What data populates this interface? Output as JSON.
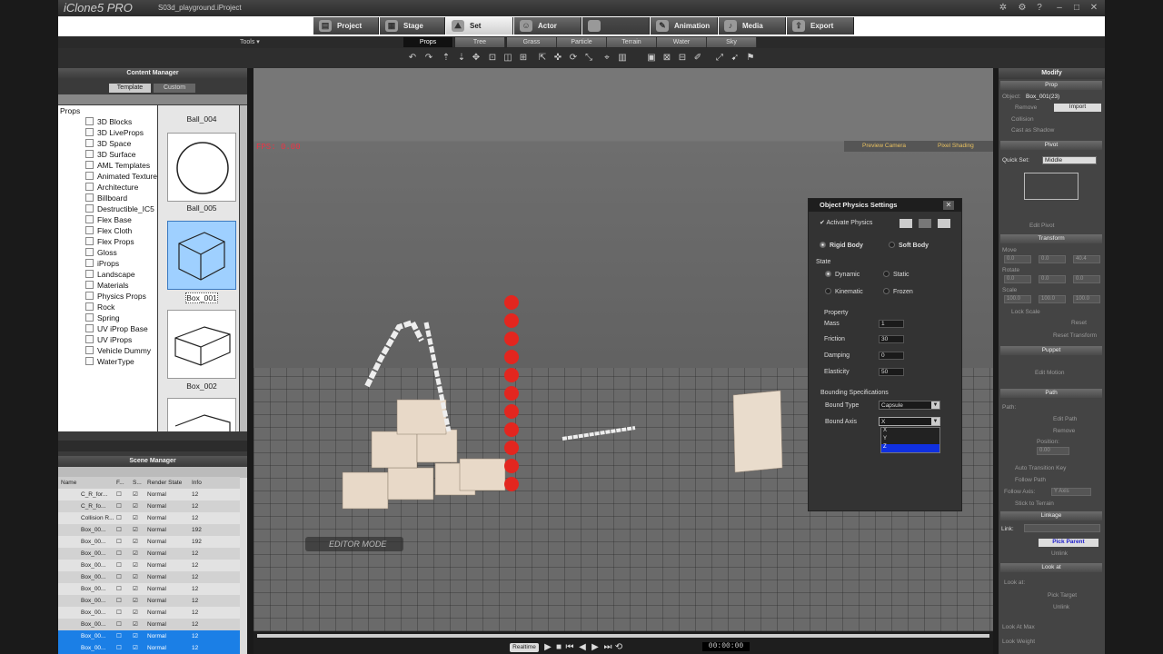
{
  "app": {
    "logo": "iClone5 PRO",
    "file": "S03d_playground.iProject"
  },
  "main_tabs": [
    {
      "label": "Project",
      "icon": "project-icon"
    },
    {
      "label": "Stage",
      "icon": "stage-icon"
    },
    {
      "label": "Set",
      "icon": "set-icon"
    },
    {
      "label": "Actor",
      "icon": "actor-icon"
    },
    {
      "label": "",
      "icon": "disabled-icon"
    },
    {
      "label": "Animation",
      "icon": "animation-icon"
    },
    {
      "label": "Media",
      "icon": "media-icon"
    },
    {
      "label": "Export",
      "icon": "export-icon"
    }
  ],
  "tools_menu": "Tools ▾",
  "sub_tabs": [
    "Props",
    "Tree",
    "Grass",
    "Particle",
    "Terrain",
    "Water",
    "Sky"
  ],
  "content_manager": {
    "title": "Content Manager",
    "tabs": [
      "Template",
      "Custom"
    ],
    "tree_root": "Props",
    "tree": [
      "3D Blocks",
      "3D LiveProps",
      "3D Space",
      "3D Surface",
      "AML Templates",
      "Animated Texture",
      "Architecture",
      "Billboard",
      "Destructible_IC5",
      "Flex Base",
      "Flex Cloth",
      "Flex Props",
      "Gloss",
      "iProps",
      "Landscape",
      "Materials",
      "Physics Props",
      "Rock",
      "Spring",
      "UV iProp Base",
      "UV iProps",
      "Vehicle Dummy",
      "WaterType"
    ],
    "thumbs": [
      "Ball_004",
      "Ball_005",
      "Box_001",
      "Box_002"
    ]
  },
  "scene_manager": {
    "title": "Scene Manager",
    "columns": [
      "Name",
      "F...",
      "S...",
      "Render State",
      "Info"
    ],
    "rows": [
      {
        "name": "C_R_for...",
        "state": "Normal",
        "info": "12"
      },
      {
        "name": "C_R_fo...",
        "state": "Normal",
        "info": "12"
      },
      {
        "name": "Collision R...",
        "state": "Normal",
        "info": "12"
      },
      {
        "name": "Box_00...",
        "state": "Normal",
        "info": "192"
      },
      {
        "name": "Box_00...",
        "state": "Normal",
        "info": "192"
      },
      {
        "name": "Box_00...",
        "state": "Normal",
        "info": "12"
      },
      {
        "name": "Box_00...",
        "state": "Normal",
        "info": "12"
      },
      {
        "name": "Box_00...",
        "state": "Normal",
        "info": "12"
      },
      {
        "name": "Box_00...",
        "state": "Normal",
        "info": "12"
      },
      {
        "name": "Box_00...",
        "state": "Normal",
        "info": "12"
      },
      {
        "name": "Box_00...",
        "state": "Normal",
        "info": "12"
      },
      {
        "name": "Box_00...",
        "state": "Normal",
        "info": "12"
      },
      {
        "name": "Box_00...",
        "state": "Normal",
        "info": "12"
      },
      {
        "name": "Box_00...",
        "state": "Normal",
        "info": "12"
      }
    ]
  },
  "viewport": {
    "fps": "FPS: 0.00",
    "preview_camera": "Preview Camera",
    "pixel_shading": "Pixel Shading",
    "editor_mode": "EDITOR MODE"
  },
  "physics": {
    "title": "Object Physics Settings",
    "activate": "Activate Physics",
    "rigid": "Rigid Body",
    "soft": "Soft Body",
    "state_label": "State",
    "states": [
      "Dynamic",
      "Static",
      "Kinematic",
      "Frozen"
    ],
    "property_label": "Property",
    "props": [
      {
        "label": "Mass",
        "value": "1"
      },
      {
        "label": "Friction",
        "value": "30"
      },
      {
        "label": "Damping",
        "value": "0"
      },
      {
        "label": "Elasticity",
        "value": "50"
      }
    ],
    "bounding_label": "Bounding Specifications",
    "bound_type_label": "Bound Type",
    "bound_type": "Capsule",
    "bound_axis_label": "Bound Axis",
    "bound_axis": "X",
    "axis_options": [
      "X",
      "Y",
      "Z"
    ]
  },
  "modify": {
    "title": "Modify",
    "prop_section": "Prop",
    "object_label": "Object:",
    "object_name": "Box_001(23)",
    "remove": "Remove",
    "import": "Import",
    "collision": "Collision",
    "cast_shadow": "Cast as Shadow",
    "pivot": "Pivot",
    "quick_set_label": "Quick Set:",
    "quick_set": "Middle",
    "edit_pivot": "Edit Pivot",
    "transform": "Transform",
    "move": "Move",
    "rotate": "Rotate",
    "scale": "Scale",
    "move_vals": [
      "0.0",
      "0.0",
      "40.4"
    ],
    "rot_vals": [
      "0.0",
      "0.0",
      "0.0"
    ],
    "scale_vals": [
      "100.0",
      "100.0",
      "100.0"
    ],
    "lock_scale": "Lock Scale",
    "reset": "Reset",
    "reset_transform": "Reset Transform",
    "puppet": "Puppet",
    "edit_motion": "Edit Motion",
    "path": "Path",
    "path_label": "Path:",
    "edit_path": "Edit Path",
    "remove_path": "Remove",
    "position": "Position:",
    "position_val": "0.00",
    "auto_transition": "Auto Transition Key",
    "follow_path": "Follow Path",
    "follow_axis_label": "Follow Axis:",
    "follow_axis": "Y Axis",
    "stick_terrain": "Stick to Terrain",
    "linkage": "Linkage",
    "link_label": "Link:",
    "pick_parent": "Pick Parent",
    "unlink": "Unlink",
    "look_at": "Look at",
    "look_at_label": "Look at:",
    "pick_target": "Pick Target",
    "unlink2": "Unlink",
    "limit_label": "Look At Max",
    "weight_label": "Look Weight"
  },
  "timeline": {
    "realtime": "Realtime",
    "time": "00:00:00"
  }
}
